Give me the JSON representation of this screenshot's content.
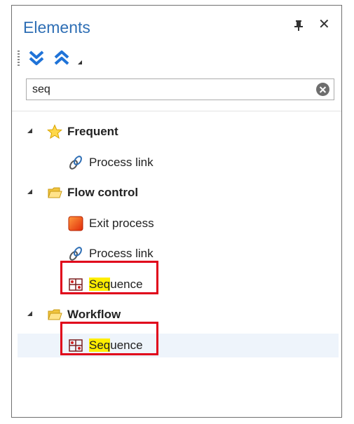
{
  "panel": {
    "title": "Elements"
  },
  "search": {
    "value": "seq"
  },
  "tree": {
    "frequent": {
      "label": "Frequent",
      "items": {
        "process_link": "Process link"
      }
    },
    "flow_control": {
      "label": "Flow control",
      "items": {
        "exit_process": "Exit process",
        "process_link": "Process link",
        "sequence": {
          "match": "Seq",
          "rest": "uence"
        }
      }
    },
    "workflow": {
      "label": "Workflow",
      "items": {
        "sequence": {
          "match": "Seq",
          "rest": "uence"
        }
      }
    }
  },
  "colors": {
    "title": "#2f6fb5",
    "highlight": "#ffee00",
    "annotation": "#e0001a",
    "accent": "#1f73d8"
  }
}
